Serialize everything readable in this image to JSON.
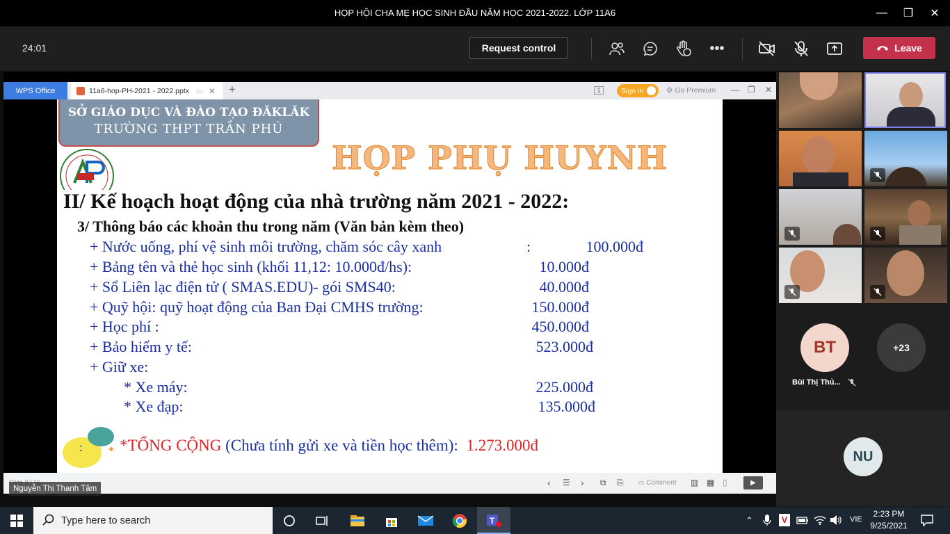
{
  "window": {
    "title": "HỌP HỘI CHA MẸ HỌC SINH ĐẦU NĂM HỌC 2021-2022. LỚP 11A6",
    "minimize": "—",
    "maximize": "❐",
    "close": "✕"
  },
  "meeting": {
    "timer": "24:01",
    "request_control": "Request control",
    "leave": "Leave",
    "leave_color": "#c4314b"
  },
  "wps": {
    "app_button": "WPS Office",
    "tab_title": "11a6-hop-PH-2021 - 2022.pptx",
    "sign_in": "Sign in",
    "premium": "Go Premium",
    "slide_counter": "Slide 9 / 16",
    "comment": "Comment"
  },
  "slide": {
    "school_line1": "SỞ GIÁO DỤC VÀ ĐÀO TẠO ĐĂKLĂK",
    "school_line2": "TRƯỜNG THPT TRẦN PHÚ",
    "big_title": "HỌP PHỤ HUYNH",
    "heading": "II/ Kế hoạch hoạt động của nhà trường năm 2021 - 2022:",
    "subheading": "3/ Thông báo các khoản thu trong năm (Văn bản kèm theo)",
    "items": [
      {
        "label": "+ Nước uống, phí vệ sinh môi trường, chăm sóc cây xanh",
        "colon": ":",
        "amount": "100.000đ"
      },
      {
        "label": "+ Bảng tên và thẻ học sinh (khối 11,12: 10.000đ/hs):",
        "amount": "10.000đ"
      },
      {
        "label": "+ Sổ Liên lạc điện tử ( SMAS.EDU)- gói SMS40:",
        "amount": "40.000đ"
      },
      {
        "label": "+ Quỹ hội: quỹ hoạt động của Ban Đại CMHS trường:",
        "amount": "150.000đ"
      },
      {
        "label": "+ Học phí :",
        "amount": "450.000đ"
      },
      {
        "label": "+ Bảo hiểm y tế:",
        "amount": "523.000đ"
      },
      {
        "label": "+ Giữ xe:",
        "amount": ""
      },
      {
        "label": "* Xe máy:",
        "amount": "225.000đ"
      },
      {
        "label": "* Xe đạp:",
        "amount": "135.000đ"
      }
    ],
    "bubble_text": ":",
    "total_label": "*TỔNG CỘNG",
    "total_note": "(Chưa tính gửi xe và tiền học thêm):",
    "total_amount": "1.273.000đ"
  },
  "presenter_name": "Nguyễn Thị Thanh Tâm",
  "participants": {
    "bt_initials": "BT",
    "bt_name": "Bùi Thị Thủ...",
    "more": "+23",
    "nu_initials": "NU"
  },
  "taskbar": {
    "search_placeholder": "Type here to search",
    "language": "VIE",
    "time": "2:23 PM",
    "date": "9/25/2021"
  }
}
